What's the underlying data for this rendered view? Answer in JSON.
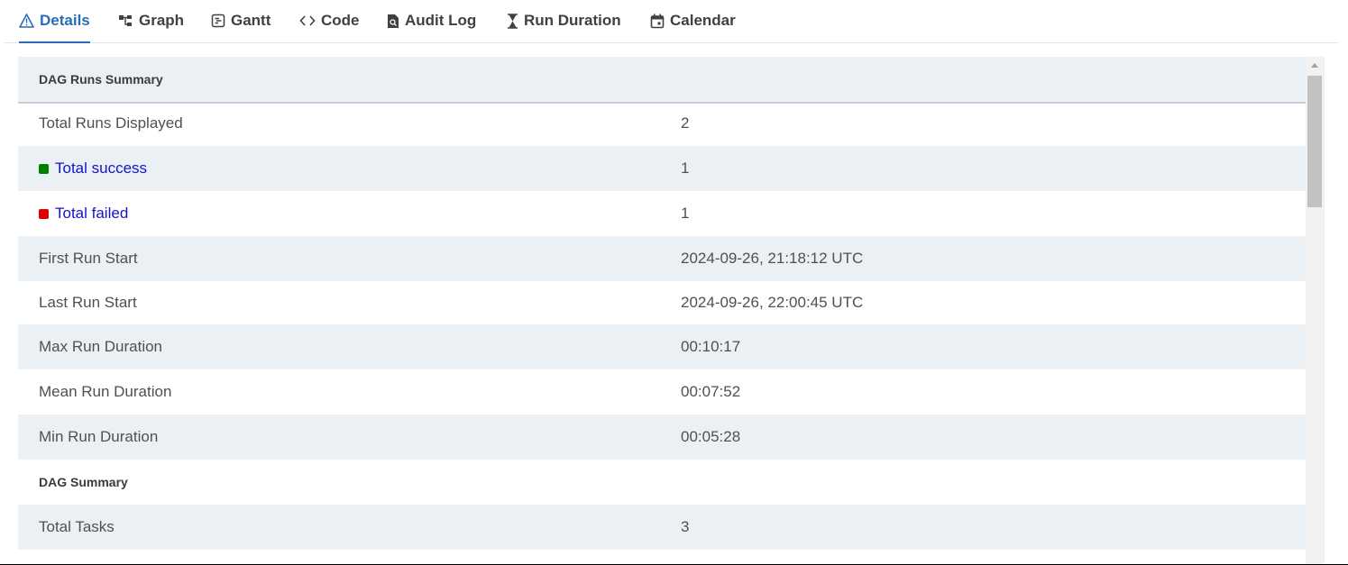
{
  "tabs": [
    {
      "label": "Details",
      "icon": "warning-triangle-icon",
      "active": true
    },
    {
      "label": "Graph",
      "icon": "graph-icon"
    },
    {
      "label": "Gantt",
      "icon": "gantt-icon"
    },
    {
      "label": "Code",
      "icon": "code-icon"
    },
    {
      "label": "Audit Log",
      "icon": "audit-log-icon"
    },
    {
      "label": "Run Duration",
      "icon": "hourglass-icon"
    },
    {
      "label": "Calendar",
      "icon": "calendar-icon"
    }
  ],
  "colors": {
    "accent": "#2a6cb8",
    "success": "#008000",
    "failed": "#e10000",
    "link": "#1414c8",
    "row_shade": "#ebf0f5"
  },
  "dag_runs_summary": {
    "heading": "DAG Runs Summary",
    "rows": [
      {
        "label": "Total Runs Displayed",
        "value": "2"
      },
      {
        "label": "Total success",
        "value": "1"
      },
      {
        "label": "Total failed",
        "value": "1"
      },
      {
        "label": "First Run Start",
        "value": "2024-09-26, 21:18:12 UTC"
      },
      {
        "label": "Last Run Start",
        "value": "2024-09-26, 22:00:45 UTC"
      },
      {
        "label": "Max Run Duration",
        "value": "00:10:17"
      },
      {
        "label": "Mean Run Duration",
        "value": "00:07:52"
      },
      {
        "label": "Min Run Duration",
        "value": "00:05:28"
      }
    ]
  },
  "dag_summary": {
    "heading": "DAG Summary",
    "rows": [
      {
        "label": "Total Tasks",
        "value": "3"
      }
    ]
  }
}
